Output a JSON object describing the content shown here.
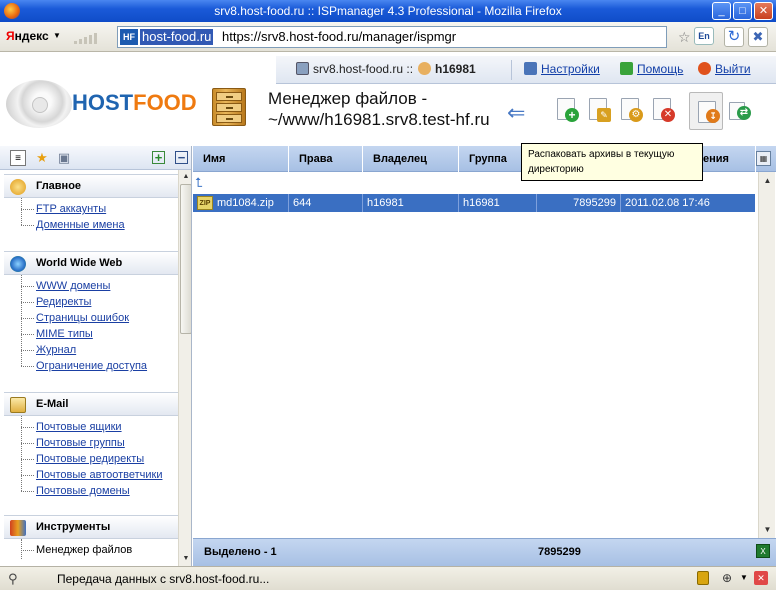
{
  "window": {
    "title": "srv8.host-food.ru :: ISPmanager 4.3 Professional - Mozilla Firefox",
    "minimize": "_",
    "maximize": "□",
    "close": "✕"
  },
  "browser": {
    "yandex_prefix": "Я",
    "yandex_rest": "ндекс",
    "dropdown": "▼",
    "site_badge": "HF",
    "url_host": "host-food.ru",
    "url_path": "https://srv8.host-food.ru/manager/ispmgr",
    "bookmark_star": "☆",
    "lang_badge": "En",
    "reload_glyph": "↻",
    "stop_glyph": "✖"
  },
  "topnav": {
    "server": "srv8.host-food.ru ::",
    "user": "h16981",
    "settings": "Настройки",
    "help": "Помощь",
    "logout": "Выйти"
  },
  "logo": {
    "part1": "HOST",
    "part2": "FOOD"
  },
  "page": {
    "title": "Менеджер файлов - ~/www/h16981.srv8.test-hf.ru"
  },
  "toolbar": {
    "back_glyph": "⇐",
    "tooltip": "Распаковать архивы в текущую директорию"
  },
  "sidebar": {
    "expand_glyph": "+",
    "collapse_glyph": "−",
    "groups": [
      {
        "title": "Главное",
        "items": [
          "FTP аккаунты",
          "Доменные имена"
        ]
      },
      {
        "title": "World Wide Web",
        "items": [
          "WWW домены",
          "Редиректы",
          "Страницы ошибок",
          "MIME типы",
          "Журнал",
          "Ограничение доступа"
        ]
      },
      {
        "title": "E-Mail",
        "items": [
          "Почтовые ящики",
          "Почтовые группы",
          "Почтовые редиректы",
          "Почтовые автоответчики",
          "Почтовые домены"
        ]
      },
      {
        "title": "Инструменты",
        "items": [
          "Менеджер файлов"
        ]
      }
    ]
  },
  "table": {
    "columns": [
      "Имя",
      "Права",
      "Владелец",
      "Группа",
      "",
      "ения"
    ],
    "up_glyph": "⮤",
    "rows": [
      {
        "type": "ZIP",
        "name": "md1084.zip",
        "perms": "644",
        "owner": "h16981",
        "group": "h16981",
        "size": "7895299",
        "modified": "2011.02.08 17:46"
      }
    ],
    "footer": {
      "selected": "Выделено - 1",
      "total_size": "7895299"
    }
  },
  "status": {
    "text": "Передача данных с srv8.host-food.ru..."
  }
}
